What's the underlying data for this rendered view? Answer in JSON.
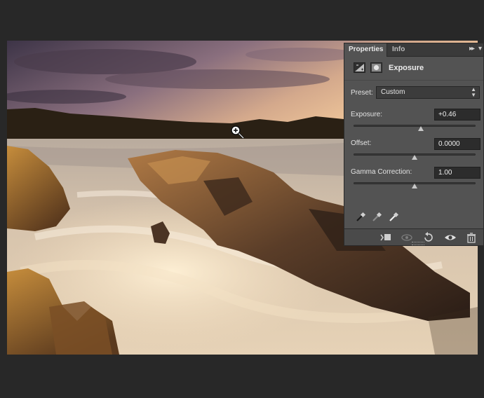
{
  "panel": {
    "tabs": [
      {
        "label": "Properties",
        "active": true
      },
      {
        "label": "Info",
        "active": false
      }
    ],
    "menu_glyph": "▸▸",
    "close_glyph": "▾",
    "header_title": "Exposure",
    "header_icons": [
      "exposure-adjustment-icon",
      "layer-mask-icon"
    ],
    "preset": {
      "label": "Preset:",
      "value": "Custom"
    },
    "exposure": {
      "label": "Exposure:",
      "value": "+0.46",
      "slider_fraction": 0.55
    },
    "offset": {
      "label": "Offset:",
      "value": "0.0000",
      "slider_fraction": 0.5
    },
    "gamma": {
      "label": "Gamma Correction:",
      "value": "1.00",
      "slider_fraction": 0.5
    },
    "eyedroppers": [
      "black-point-eyedropper-icon",
      "gray-point-eyedropper-icon",
      "white-point-eyedropper-icon"
    ],
    "footer_icons": [
      "clip-to-layer-icon",
      "view-previous-state-icon",
      "reset-icon",
      "visibility-eye-icon",
      "delete-trash-icon"
    ]
  },
  "canvas": {
    "subject": "river rapids with rocks at sunset",
    "cursor": "zoom-in-icon"
  },
  "colors": {
    "workspace": "#282828",
    "panel": "#535353",
    "field": "#2c2c2c"
  }
}
